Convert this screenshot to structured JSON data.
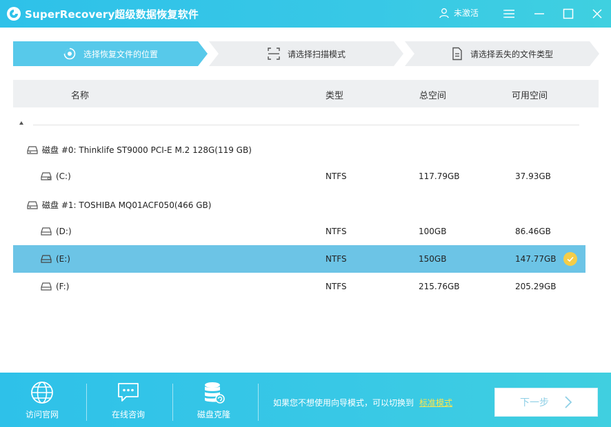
{
  "app": {
    "title": "SuperRecovery超级数据恢复软件",
    "user_status": "未激活"
  },
  "steps": [
    {
      "label": "选择恢复文件的位置",
      "icon": "location-target-icon",
      "active": true
    },
    {
      "label": "请选择扫描模式",
      "icon": "scan-frame-icon",
      "active": false
    },
    {
      "label": "请选择丢失的文件类型",
      "icon": "document-icon",
      "active": false
    }
  ],
  "table": {
    "headers": {
      "name": "名称",
      "type": "类型",
      "total": "总空间",
      "free": "可用空间"
    },
    "disks": [
      {
        "label": "磁盘 #0: Thinklife ST9000 PCI-E M.2 128G(119 GB)",
        "partitions": [
          {
            "name": "(C:)",
            "type": "NTFS",
            "total": "117.79GB",
            "free": "37.93GB",
            "selected": false,
            "system": true
          }
        ]
      },
      {
        "label": "磁盘 #1: TOSHIBA MQ01ACF050(466 GB)",
        "partitions": [
          {
            "name": "(D:)",
            "type": "NTFS",
            "total": "100GB",
            "free": "86.46GB",
            "selected": false
          },
          {
            "name": "(E:)",
            "type": "NTFS",
            "total": "150GB",
            "free": "147.77GB",
            "selected": true
          },
          {
            "name": "(F:)",
            "type": "NTFS",
            "total": "215.76GB",
            "free": "205.29GB",
            "selected": false
          }
        ]
      }
    ]
  },
  "footer": {
    "items": [
      {
        "label": "访问官网",
        "icon": "globe-icon"
      },
      {
        "label": "在线咨询",
        "icon": "chat-icon"
      },
      {
        "label": "磁盘克隆",
        "icon": "database-clone-icon"
      }
    ],
    "hint_text": "如果您不想使用向导模式，可以切换到",
    "hint_link": "标准模式",
    "next_label": "下一步"
  },
  "colors": {
    "accent": "#38c8e6",
    "selected_row": "#6cc4e6",
    "check": "#f5cd47",
    "link": "#ffe64a"
  }
}
